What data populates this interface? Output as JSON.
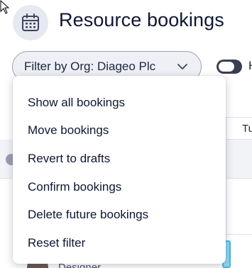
{
  "header": {
    "title": "Resource bookings",
    "icon": "calendar-icon"
  },
  "filter": {
    "label": "Filter by Org: Diageo Plc",
    "chevron_icon": "chevron-down-icon"
  },
  "toggle": {
    "label": "H",
    "state": "off"
  },
  "menu": {
    "items": [
      {
        "label": "Show all bookings"
      },
      {
        "label": "Move bookings"
      },
      {
        "label": "Revert to drafts"
      },
      {
        "label": "Confirm bookings"
      },
      {
        "label": "Delete future bookings"
      },
      {
        "label": "Reset filter"
      }
    ]
  },
  "background": {
    "column_head": "Tu",
    "role": "Designer"
  },
  "colors": {
    "text": "#0f1633",
    "pill_bg": "#eef0f5",
    "booking_fill": "#8fd6f0",
    "booking_border": "#4fb7e0"
  }
}
